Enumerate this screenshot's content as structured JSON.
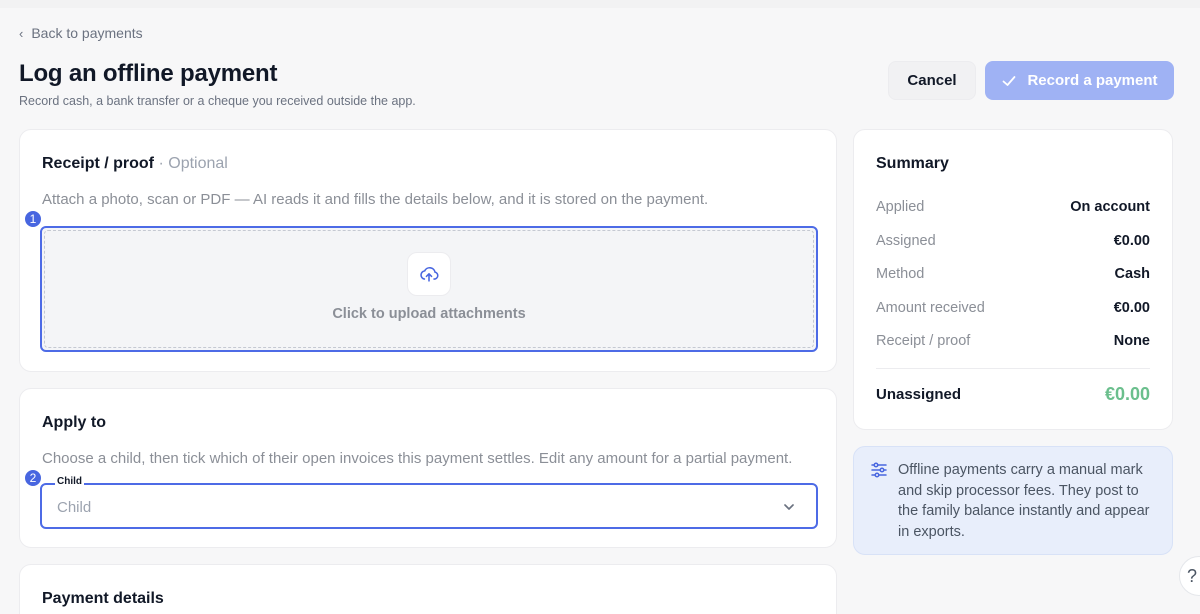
{
  "nav": {
    "back_label": "Back to payments"
  },
  "header": {
    "title": "Log an offline payment",
    "subtitle": "Record cash, a bank transfer or a cheque you received outside the app.",
    "cancel_label": "Cancel",
    "record_label": "Record a payment"
  },
  "receipt": {
    "title": "Receipt / proof",
    "optional": "· Optional",
    "description": "Attach a photo, scan or PDF — AI reads it and fills the details below, and it is stored on the payment.",
    "step": "1",
    "upload_label": "Click to upload attachments"
  },
  "apply": {
    "title": "Apply to",
    "description": "Choose a child, then tick which of their open invoices this payment settles. Edit any amount for a partial payment.",
    "step": "2",
    "child_field_label": "Child",
    "child_placeholder": "Child"
  },
  "payment_details": {
    "title": "Payment details"
  },
  "summary": {
    "title": "Summary",
    "rows": [
      {
        "label": "Applied",
        "value": "On account"
      },
      {
        "label": "Assigned",
        "value": "€0.00"
      },
      {
        "label": "Method",
        "value": "Cash"
      },
      {
        "label": "Amount received",
        "value": "€0.00"
      },
      {
        "label": "Receipt / proof",
        "value": "None"
      }
    ],
    "unassigned_label": "Unassigned",
    "unassigned_value": "€0.00"
  },
  "info": {
    "text": "Offline payments carry a manual mark and skip processor fees. They post to the family balance instantly and appear in exports."
  },
  "help": {
    "glyph": "?"
  },
  "colors": {
    "accent": "#4d6be6",
    "primary_button_disabled": "#9fb2f4",
    "unassigned_green": "#6bbf8d",
    "info_bg": "#e8eefb"
  }
}
